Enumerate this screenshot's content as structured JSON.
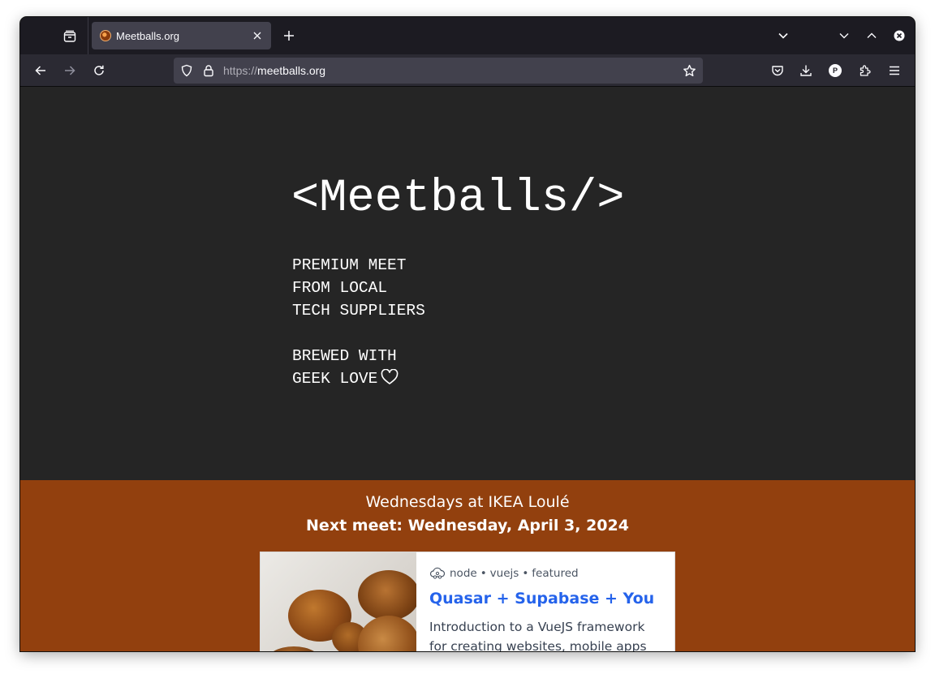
{
  "browser": {
    "tab": {
      "title": "Meetballs.org"
    },
    "url": {
      "protocol": "https://",
      "host": "meetballs.org"
    },
    "profile_initial": "P"
  },
  "hero": {
    "title": "<Meetballs/>",
    "tagline_lines": [
      "PREMIUM MEET",
      "FROM LOCAL",
      "TECH SUPPLIERS"
    ],
    "love_lines": [
      "BREWED WITH",
      "GEEK LOVE"
    ]
  },
  "schedule": {
    "location": "Wednesdays at IKEA Loulé",
    "next_meet": "Next meet: Wednesday, April 3, 2024"
  },
  "card": {
    "tags": [
      "node",
      "vuejs",
      "featured"
    ],
    "tag_separator": "•",
    "title": "Quasar + Supabase + You",
    "description": "Introduction to a VueJS framework for creating websites, mobile apps and"
  },
  "colors": {
    "page_bg": "#252525",
    "band_bg": "#92400e",
    "card_title": "#2563eb"
  }
}
